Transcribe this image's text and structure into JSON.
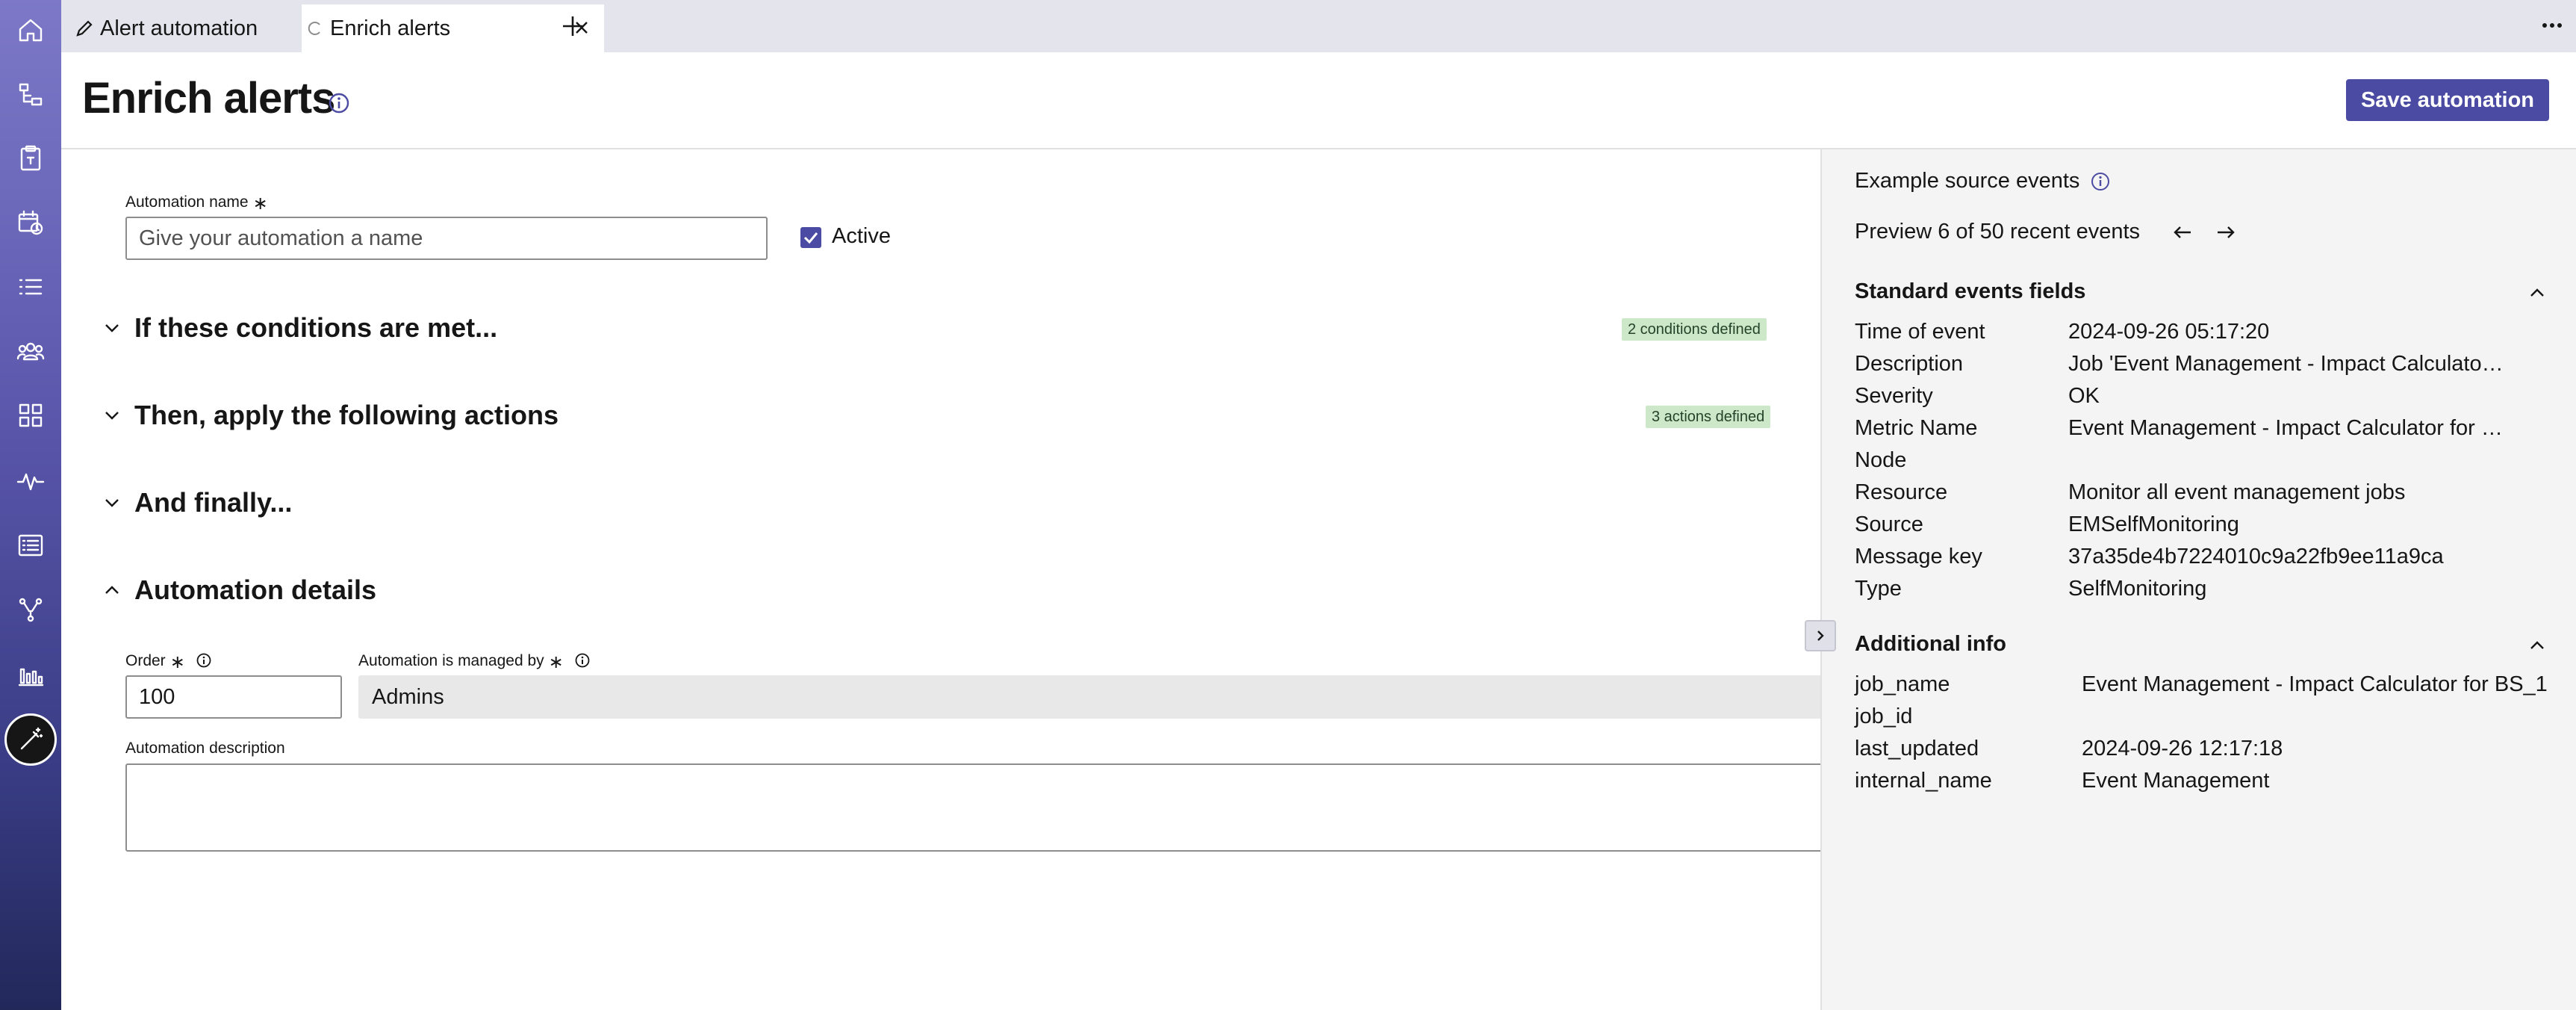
{
  "tabs": [
    {
      "label": "Alert automation"
    },
    {
      "label": "Enrich alerts"
    }
  ],
  "header": {
    "title": "Enrich alerts",
    "save_label": "Save automation"
  },
  "form": {
    "name_label": "Automation name",
    "required_mark": "∗",
    "name_placeholder": "Give your automation a name",
    "active_label": "Active",
    "active_checked": true,
    "sections": [
      {
        "title": "If these conditions are met...",
        "badge": "2 conditions defined",
        "expanded": false
      },
      {
        "title": "Then, apply the following actions",
        "badge": "3 actions defined",
        "expanded": false
      },
      {
        "title": "And finally...",
        "badge": "",
        "expanded": false
      },
      {
        "title": "Automation details",
        "badge": "",
        "expanded": true
      }
    ],
    "order_label": "Order",
    "order_value": "100",
    "managed_by_label": "Automation is managed by",
    "managed_by_value": "Admins",
    "description_label": "Automation description",
    "description_value": ""
  },
  "panel": {
    "title": "Example source events",
    "preview": "Preview 6 of 50 recent events",
    "standard_title": "Standard events fields",
    "standard_fields": [
      {
        "key": "Time of event",
        "value": "2024-09-26 05:17:20"
      },
      {
        "key": "Description",
        "value": "Job 'Event Management - Impact Calculator f..."
      },
      {
        "key": "Severity",
        "value": "OK"
      },
      {
        "key": "Metric Name",
        "value": "Event Management - Impact Calculator for B..."
      },
      {
        "key": "Node",
        "value": ""
      },
      {
        "key": "Resource",
        "value": "Monitor all event management jobs"
      },
      {
        "key": "Source",
        "value": "EMSelfMonitoring"
      },
      {
        "key": "Message key",
        "value": "37a35de4b7224010c9a22fb9ee11a9ca"
      },
      {
        "key": "Type",
        "value": "SelfMonitoring"
      }
    ],
    "additional_title": "Additional info",
    "additional_fields": [
      {
        "key": "job_name",
        "value": "Event Management - Impact Calculator for BS_1"
      },
      {
        "key": "job_id",
        "value": ""
      },
      {
        "key": "last_updated",
        "value": "2024-09-26 12:17:18"
      },
      {
        "key": "internal_name",
        "value": "Event Management"
      }
    ]
  },
  "nav_icons": [
    "home-icon",
    "hierarchy-icon",
    "clipboard-icon",
    "calendar-clock-icon",
    "list-icon",
    "group-icon",
    "dashboard-grid-icon",
    "pulse-icon",
    "report-list-icon",
    "flow-icon",
    "bar-chart-icon",
    "automation-wand-icon"
  ],
  "colors": {
    "accent": "#4b4ba3",
    "badge_bg": "#cde8c9",
    "rail_top": "#7d79c8",
    "rail_bottom": "#22285a"
  }
}
